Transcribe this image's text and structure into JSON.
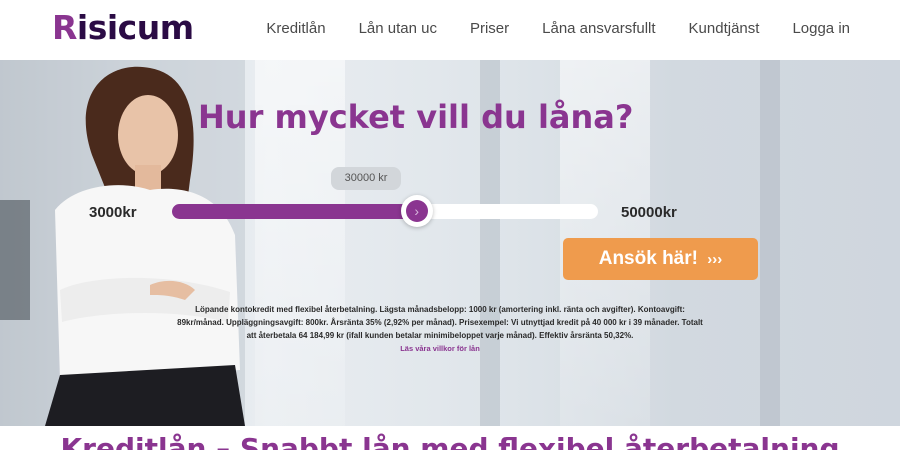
{
  "brand": {
    "logo_text": "Risicum",
    "accent": "#8a3590",
    "dark": "#2b0b45",
    "cta_color": "#ef9b4d"
  },
  "nav": {
    "items": [
      "Kreditlån",
      "Lån utan uc",
      "Priser",
      "Låna ansvarsfullt",
      "Kundtjänst",
      "Logga in"
    ]
  },
  "hero": {
    "headline": "Hur mycket vill du låna?",
    "slider": {
      "min_label": "3000kr",
      "max_label": "50000kr",
      "value_label": "30000 kr",
      "min": 3000,
      "max": 50000,
      "value": 30000
    },
    "apply_label": "Ansök här!",
    "apply_arrows": "›››",
    "disclaimer": "Löpande kontokredit med flexibel återbetalning. Lägsta månadsbelopp: 1000 kr (amortering inkl. ränta och avgifter). Kontoavgift: 89kr/månad. Uppläggningsavgift: 800kr. Årsränta 35% (2,92% per månad). Prisexempel: Vi utnyttjad kredit på 40 000 kr i 39 månader. Totalt att återbetala 64 184,99 kr (ifall kunden betalar minimibeloppet varje månad). Effektiv årsränta 50,32%.",
    "terms_link": "Läs våra villkor för lån"
  },
  "section": {
    "heading": "Kreditlån – Snabbt lån med flexibel återbetalning"
  }
}
